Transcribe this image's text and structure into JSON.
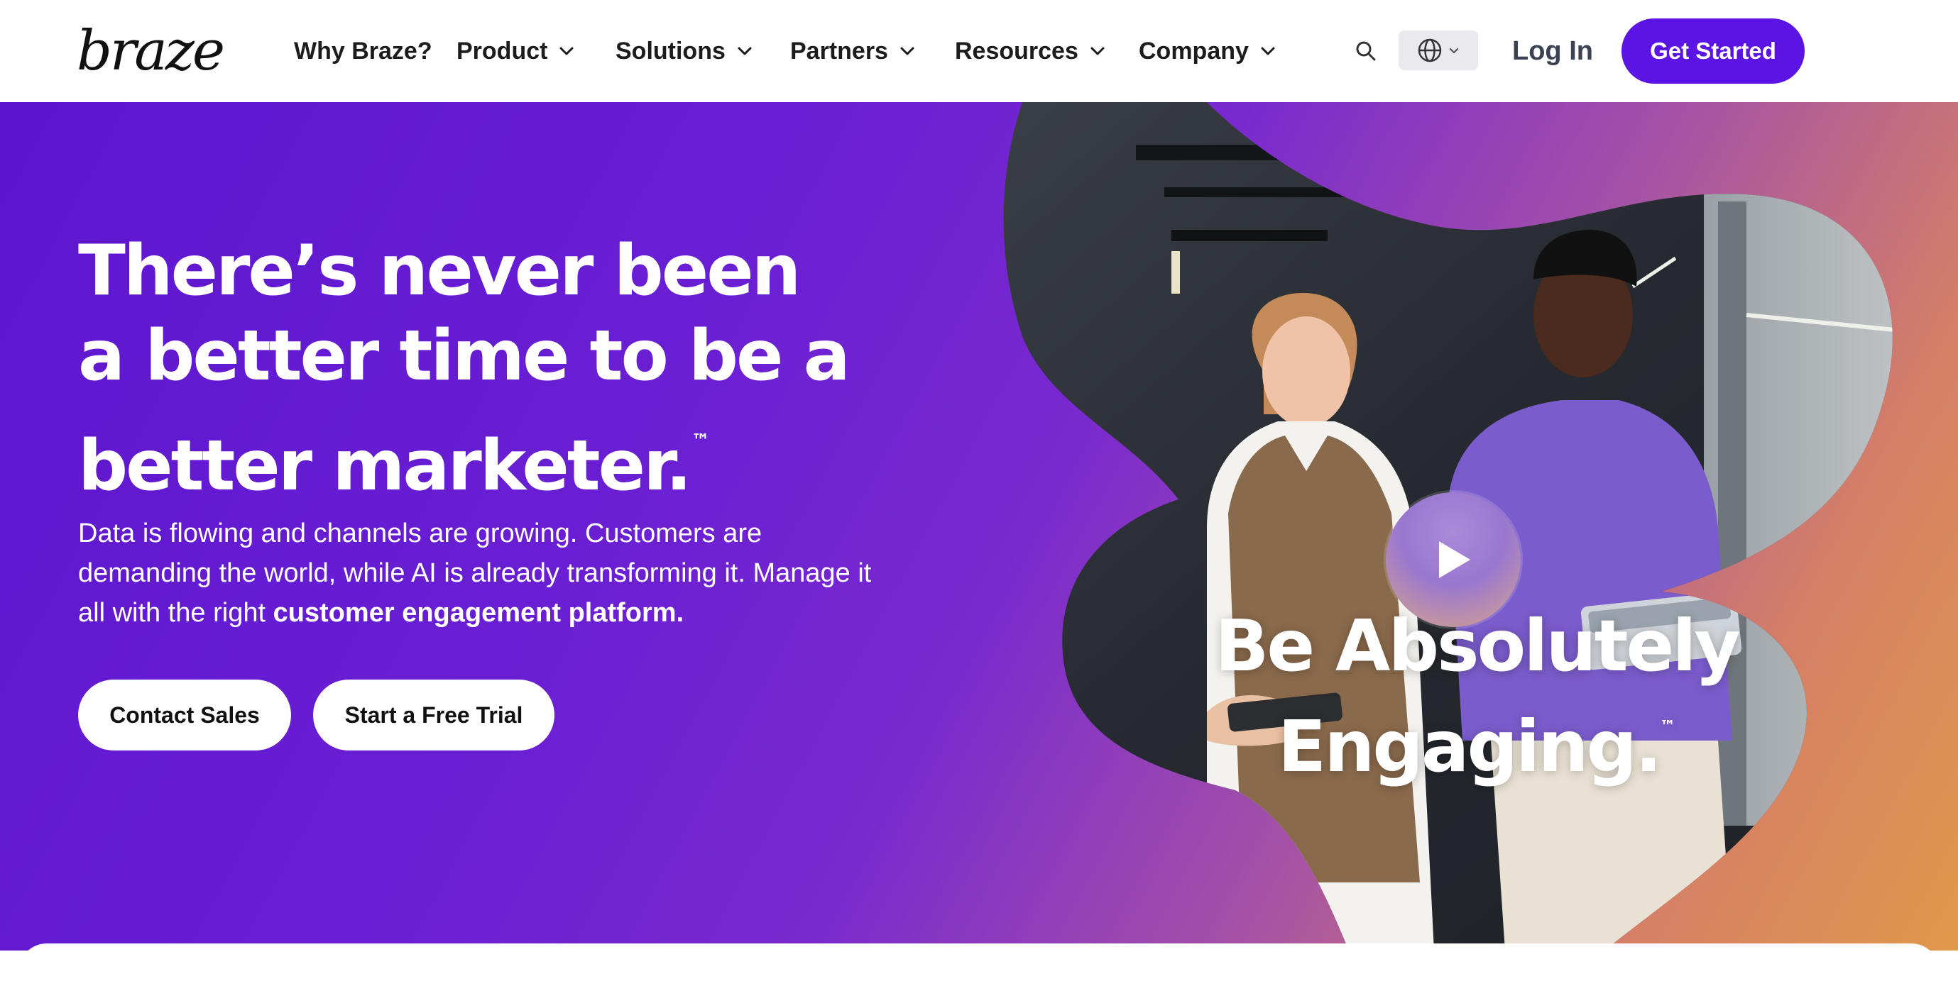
{
  "header": {
    "logo_text": "braze",
    "nav": [
      {
        "label": "Why Braze?",
        "dropdown": false
      },
      {
        "label": "Product",
        "dropdown": true
      },
      {
        "label": "Solutions",
        "dropdown": true
      },
      {
        "label": "Partners",
        "dropdown": true
      },
      {
        "label": "Resources",
        "dropdown": true
      },
      {
        "label": "Company",
        "dropdown": true
      }
    ],
    "search_icon": "search-icon",
    "language_icon": "globe-icon",
    "login_label": "Log In",
    "cta_label": "Get Started"
  },
  "hero": {
    "headline": "There’s never been a better time to be a better marketer.",
    "headline_mark": "™",
    "subtext_lead": "Data is flowing and channels are growing. Customers are demanding the world, while AI is already transforming it. Manage it all with the right ",
    "subtext_bold": "customer engagement platform.",
    "primary_button": "Contact Sales",
    "secondary_button": "Start a Free Trial",
    "video": {
      "caption_line1": "Be Absolutely",
      "caption_line2": "Engaging.",
      "caption_mark": "™",
      "play_icon": "play-icon"
    }
  },
  "colors": {
    "brand_purple": "#5b14e4",
    "hero_gradient_start": "#5c16cf",
    "hero_gradient_end": "#e2984a",
    "button_bg": "#ffffff"
  }
}
